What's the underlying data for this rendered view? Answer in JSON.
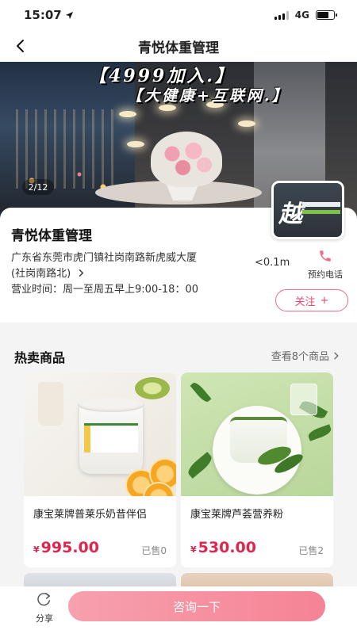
{
  "status_bar": {
    "time": "15:07",
    "network": "4G",
    "battery_level": 0.7
  },
  "nav": {
    "title": "青悦体重管理",
    "back_icon": "chevron-left-icon"
  },
  "banner": {
    "headline_1": "【4999加入.】",
    "headline_2": "【大健康+互联网.】",
    "page_indicator": "2/12"
  },
  "store": {
    "name": "青悦体重管理",
    "address": "广东省东莞市虎门镇社岗南路新虎威大厦(社岗南路北)",
    "hours_label": "营业时间：",
    "hours_value": "周一至周五早上9:00-18：00",
    "distance": "<0.1m",
    "call_label": "预约电话",
    "follow_label": "关注",
    "follow_icon": "+",
    "logo_char": "越"
  },
  "hot_products": {
    "title": "热卖商品",
    "view_all": "查看8个商品",
    "items": [
      {
        "name": "康宝莱牌普莱乐奶昔伴侣",
        "currency": "¥",
        "price": "995.00",
        "sold": "已售0"
      },
      {
        "name": "康宝莱牌芦荟营养粉",
        "currency": "¥",
        "price": "530.00",
        "sold": "已售2"
      }
    ]
  },
  "bottom_bar": {
    "share_label": "分享",
    "consult_label": "咨询一下"
  },
  "colors": {
    "accent": "#e8476b",
    "consult_button": "#f58395",
    "price": "#e0264f"
  }
}
